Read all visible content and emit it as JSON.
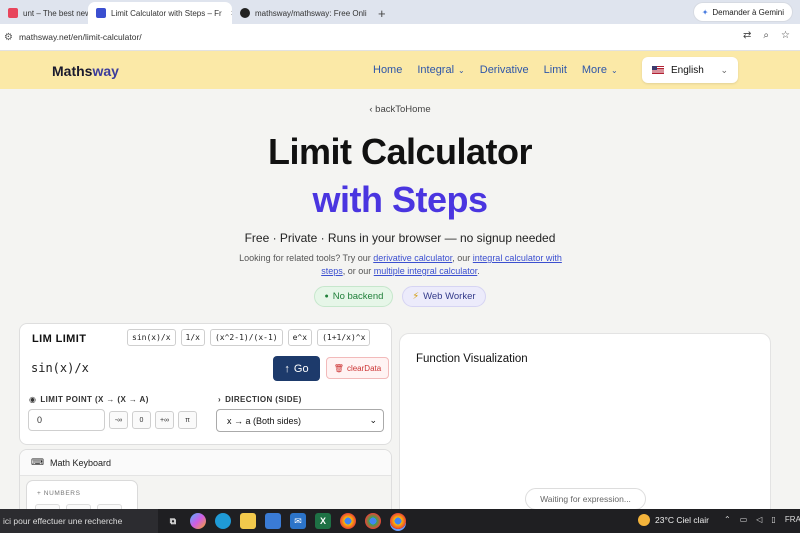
{
  "browser": {
    "tabs": [
      {
        "label": "unt – The best new p",
        "favicon_color": "#e8455c",
        "active": false
      },
      {
        "label": "Limit Calculator with Steps – Fr",
        "favicon_color": "#3b4fd0",
        "active": true
      },
      {
        "label": "mathsway/mathsway: Free Onli",
        "favicon_color": "#222222",
        "active": false
      }
    ],
    "close_glyph": "×",
    "new_tab_glyph": "+",
    "gemini_label": "Demander à Gemini",
    "url": "mathsway.net/en/limit-calculator/"
  },
  "site": {
    "logo_main": "Maths",
    "logo_accent": "way",
    "nav": [
      {
        "label": "Home",
        "dropdown": false
      },
      {
        "label": "Integral",
        "dropdown": true
      },
      {
        "label": "Derivative",
        "dropdown": false
      },
      {
        "label": "Limit",
        "dropdown": false
      },
      {
        "label": "More",
        "dropdown": true
      }
    ],
    "language": "English"
  },
  "hero": {
    "back_link": "backToHome",
    "title_line1": "Limit Calculator",
    "title_line2": "with Steps",
    "tagline": "Free · Private · Runs in your browser — no signup needed",
    "related_prefix": "Looking for related tools? Try our ",
    "related_link1": "derivative calculator",
    "related_mid1": ", our ",
    "related_link2": "integral calculator with steps",
    "related_mid2": ", or our ",
    "related_link3": "multiple integral calculator",
    "related_suffix": ".",
    "badge1": "No backend",
    "badge2": "Web Worker"
  },
  "calculator": {
    "title": "LIM LIMIT",
    "presets": [
      "sin(x)/x",
      "1/x",
      "(x^2-1)/(x-1)",
      "e^x",
      "(1+1/x)^x"
    ],
    "expression": "sin(x)/x",
    "go_label": "Go",
    "clear_label": "clearData",
    "limit_point_label": "LIMIT POINT (X → (X → A)",
    "limit_point_value": "0",
    "point_buttons": [
      "-∞",
      "0",
      "+∞",
      "π"
    ],
    "direction_label": "DIRECTION (SIDE)",
    "direction_value": "x → a (Both sides)"
  },
  "keyboard": {
    "title": "Math Keyboard",
    "section_label": "+ NUMBERS"
  },
  "visualization": {
    "title": "Function Visualization",
    "status": "Waiting for expression..."
  },
  "taskbar": {
    "search_text": "ici pour effectuer une recherche",
    "weather": "23°C  Ciel clair",
    "lang": "FRA"
  },
  "colors": {
    "header_bg": "#fbe9a7",
    "accent_purple": "#4a35e0",
    "go_button": "#1d3a6b"
  }
}
